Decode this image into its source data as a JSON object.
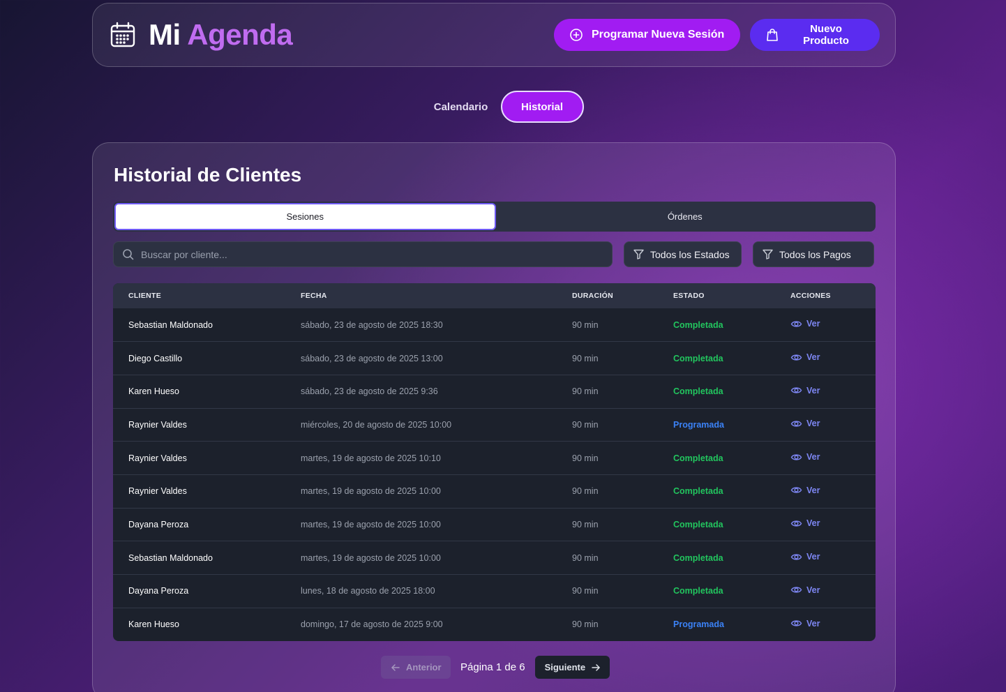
{
  "header": {
    "title_word1": "Mi",
    "title_word2": "Agenda",
    "schedule_button": "Programar Nueva Sesión",
    "new_product_button": "Nuevo Producto"
  },
  "main_tabs": {
    "calendar": "Calendario",
    "history": "Historial",
    "active": "Historial"
  },
  "panel": {
    "title": "Historial de Clientes",
    "subtabs": {
      "sessions": "Sesiones",
      "orders": "Órdenes",
      "active": "Sesiones"
    },
    "search": {
      "placeholder": "Buscar por cliente...",
      "value": ""
    },
    "filter_status": "Todos los Estados",
    "filter_payments": "Todos los Pagos"
  },
  "table": {
    "headers": [
      "CLIENTE",
      "FECHA",
      "DURACIÓN",
      "ESTADO",
      "ACCIONES"
    ],
    "rows": [
      {
        "client": "Sebastian Maldonado",
        "date": "sábado, 23 de agosto de 2025 18:30",
        "duration": "90 min",
        "status": "Completada",
        "action": "Ver"
      },
      {
        "client": "Diego Castillo",
        "date": "sábado, 23 de agosto de 2025 13:00",
        "duration": "90 min",
        "status": "Completada",
        "action": "Ver"
      },
      {
        "client": "Karen Hueso",
        "date": "sábado, 23 de agosto de 2025 9:36",
        "duration": "90 min",
        "status": "Completada",
        "action": "Ver"
      },
      {
        "client": "Raynier Valdes",
        "date": "miércoles, 20 de agosto de 2025 10:00",
        "duration": "90 min",
        "status": "Programada",
        "action": "Ver"
      },
      {
        "client": "Raynier Valdes",
        "date": "martes, 19 de agosto de 2025 10:10",
        "duration": "90 min",
        "status": "Completada",
        "action": "Ver"
      },
      {
        "client": "Raynier Valdes",
        "date": "martes, 19 de agosto de 2025 10:00",
        "duration": "90 min",
        "status": "Completada",
        "action": "Ver"
      },
      {
        "client": "Dayana Peroza",
        "date": "martes, 19 de agosto de 2025 10:00",
        "duration": "90 min",
        "status": "Completada",
        "action": "Ver"
      },
      {
        "client": "Sebastian Maldonado",
        "date": "martes, 19 de agosto de 2025 10:00",
        "duration": "90 min",
        "status": "Completada",
        "action": "Ver"
      },
      {
        "client": "Dayana Peroza",
        "date": "lunes, 18 de agosto de 2025 18:00",
        "duration": "90 min",
        "status": "Completada",
        "action": "Ver"
      },
      {
        "client": "Karen Hueso",
        "date": "domingo, 17 de agosto de 2025 9:00",
        "duration": "90 min",
        "status": "Programada",
        "action": "Ver"
      }
    ]
  },
  "pagination": {
    "prev": "Anterior",
    "label": "Página 1 de 6",
    "next": "Siguiente"
  },
  "colors": {
    "accent_purple": "#a11cf2",
    "accent_indigo": "#5b2cf0",
    "status_completed": "#22c55e",
    "status_scheduled": "#3b82f6",
    "link": "#7d86f2"
  },
  "icons": {
    "brand": "calendar-icon",
    "schedule": "plus-circle-icon",
    "product": "shopping-bag-icon",
    "search": "search-icon",
    "filter": "filter-icon",
    "view": "eye-icon",
    "prev": "arrow-left-icon",
    "next": "arrow-right-icon"
  }
}
